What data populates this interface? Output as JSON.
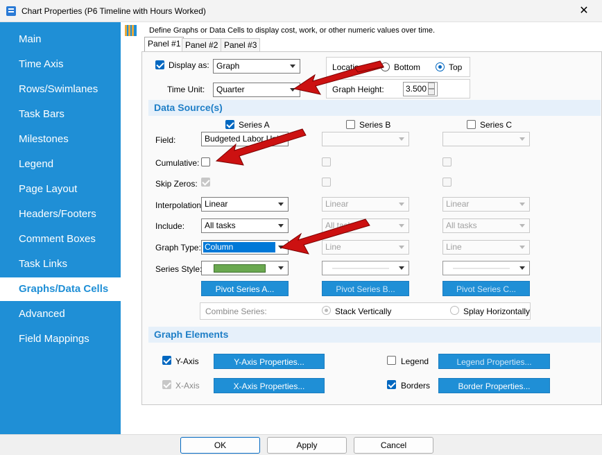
{
  "window": {
    "title": "Chart Properties (P6 Timeline with Hours Worked)",
    "close": "✕"
  },
  "sidebar": {
    "items": [
      {
        "label": "Main"
      },
      {
        "label": "Time Axis"
      },
      {
        "label": "Rows/Swimlanes"
      },
      {
        "label": "Task Bars"
      },
      {
        "label": "Milestones"
      },
      {
        "label": "Legend"
      },
      {
        "label": "Page Layout"
      },
      {
        "label": "Headers/Footers"
      },
      {
        "label": "Comment Boxes"
      },
      {
        "label": "Task Links"
      },
      {
        "label": "Graphs/Data Cells",
        "active": true
      },
      {
        "label": "Advanced"
      },
      {
        "label": "Field Mappings"
      }
    ]
  },
  "header": {
    "description": "Define Graphs or Data Cells to display cost, work, or other numeric values over time."
  },
  "tabs": [
    {
      "label": "Panel #1",
      "active": true
    },
    {
      "label": "Panel #2"
    },
    {
      "label": "Panel #3"
    }
  ],
  "display": {
    "label": "Display as:",
    "value": "Graph",
    "checked": true,
    "time_unit_label": "Time Unit:",
    "time_unit": "Quarter",
    "location_label": "Location",
    "bottom": "Bottom",
    "top": "Top",
    "graph_height_label": "Graph Height:",
    "graph_height": "3.500"
  },
  "data_source": {
    "title": "Data Source(s)",
    "row_labels": {
      "field": "Field:",
      "cumulative": "Cumulative:",
      "skip_zeros": "Skip Zeros:",
      "interpolation": "Interpolation:",
      "include": "Include:",
      "graph_type": "Graph Type:",
      "series_style": "Series Style:"
    },
    "series": [
      {
        "name": "Series A",
        "enabled": true,
        "field": "Budgeted Labor Units",
        "interpolation": "Linear",
        "include": "All tasks",
        "graph_type": "Column",
        "pivot": "Pivot Series A...",
        "style_color": "#6aa84f"
      },
      {
        "name": "Series B",
        "enabled": false,
        "field": "",
        "interpolation": "Linear",
        "include": "All tasks",
        "graph_type": "Line",
        "pivot": "Pivot Series B..."
      },
      {
        "name": "Series C",
        "enabled": false,
        "field": "",
        "interpolation": "Linear",
        "include": "All tasks",
        "graph_type": "Line",
        "pivot": "Pivot Series C..."
      }
    ],
    "combine_label": "Combine Series:",
    "stack": "Stack Vertically",
    "splay": "Splay Horizontally"
  },
  "graph_elements": {
    "title": "Graph Elements",
    "y_axis": "Y-Axis",
    "y_axis_btn": "Y-Axis Properties...",
    "x_axis": "X-Axis",
    "x_axis_btn": "X-Axis Properties...",
    "legend": "Legend",
    "legend_btn": "Legend Properties...",
    "borders": "Borders",
    "borders_btn": "Border Properties..."
  },
  "footer": {
    "ok": "OK",
    "apply": "Apply",
    "cancel": "Cancel"
  },
  "colors": {
    "accent": "#1f8fd6",
    "arrow": "#cc1111"
  }
}
